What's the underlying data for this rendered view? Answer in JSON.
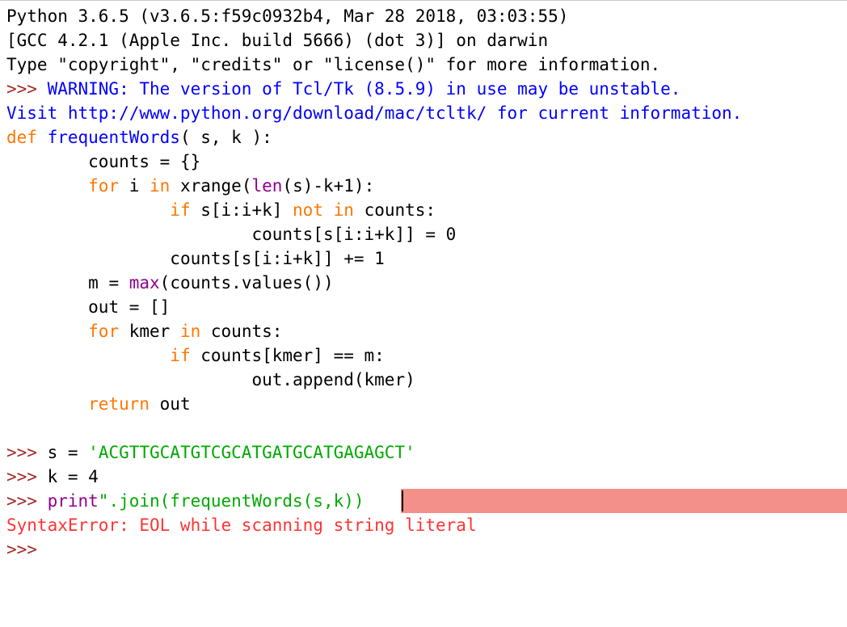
{
  "colors": {
    "background": "#ffffff",
    "keyword": "#ff7700",
    "definition": "#0000ff",
    "builtin": "#900090",
    "string": "#00aa00",
    "prompt": "#a52a2a",
    "stdout_warning": "#0000ff",
    "error": "#ff3333",
    "error_highlight": "#f4908a"
  },
  "banner": {
    "line1": "Python 3.6.5 (v3.6.5:f59c0932b4, Mar 28 2018, 03:03:55)",
    "line2": "[GCC 4.2.1 (Apple Inc. build 5666) (dot 3)] on darwin",
    "line3": "Type \"copyright\", \"credits\" or \"license()\" for more information."
  },
  "warning": {
    "prompt": ">>> ",
    "line1": "WARNING: The version of Tcl/Tk (8.5.9) in use may be unstable.",
    "line2": "Visit http://www.python.org/download/mac/tcltk/ for current information."
  },
  "code": {
    "l1": {
      "kw": "def",
      "name": "frequentWords",
      "rest": "( s, k ):"
    },
    "l2": {
      "indent": "        ",
      "text": "counts = {}"
    },
    "l3": {
      "indent": "        ",
      "kw1": "for",
      "t1": " i ",
      "kw2": "in",
      "t2": " xrange(",
      "bi": "len",
      "t3": "(s)-k+1):"
    },
    "l4": {
      "indent": "                ",
      "kw1": "if",
      "t1": " s[i:i+k] ",
      "kw2": "not",
      "t2": " ",
      "kw3": "in",
      "t3": " counts:"
    },
    "l5": {
      "indent": "                        ",
      "text": "counts[s[i:i+k]] = 0"
    },
    "l6": {
      "indent": "                ",
      "text": "counts[s[i:i+k]] += 1"
    },
    "l7": {
      "indent": "        ",
      "t1": "m = ",
      "bi": "max",
      "t2": "(counts.values())"
    },
    "l8": {
      "indent": "        ",
      "text": "out = []"
    },
    "l9": {
      "indent": "        ",
      "kw1": "for",
      "t1": " kmer ",
      "kw2": "in",
      "t2": " counts:"
    },
    "l10": {
      "indent": "                ",
      "kw1": "if",
      "t1": " counts[kmer] == m:"
    },
    "l11": {
      "indent": "                        ",
      "text": "out.append(kmer)"
    },
    "l12": {
      "indent": "        ",
      "kw1": "return",
      "t1": " out"
    }
  },
  "session": {
    "prompt": ">>> ",
    "s_assign": "s = ",
    "s_value": "'ACGTTGCATGTCGCATGATGCATGAGAGCT'",
    "k_assign": "k = 4",
    "print_kw": "print",
    "print_rest": "\".join(frequentWords(s,k))",
    "error": "SyntaxError: EOL while scanning string literal",
    "final_prompt": ">>> "
  }
}
